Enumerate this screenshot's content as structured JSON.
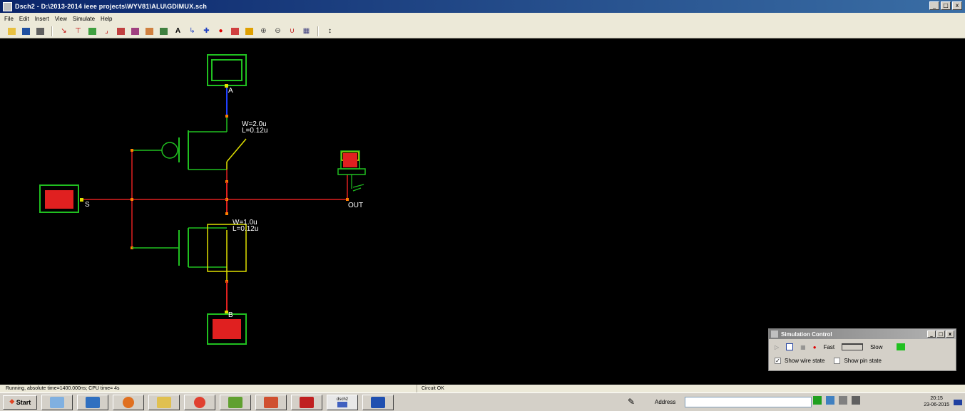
{
  "window": {
    "title": "Dsch2 - D:\\2013-2014 ieee projects\\WYV81\\ALU\\GDIMUX.sch",
    "controls": [
      "_",
      "□",
      "x"
    ]
  },
  "menu": [
    "File",
    "Edit",
    "Insert",
    "View",
    "Simulate",
    "Help"
  ],
  "toolbar": {
    "icons": [
      "open-icon",
      "save-icon",
      "print-icon",
      "arrow-icon",
      "nmos-icon",
      "pmos-icon",
      "wire-icon",
      "component-icon",
      "symbol-icon",
      "grid-icon",
      "bus-icon",
      "text-icon",
      "connect-icon",
      "line-icon",
      "run-icon",
      "timing-icon",
      "chart-icon",
      "zoom-in-icon",
      "zoom-out-icon",
      "extract-icon",
      "layout-icon",
      "move-icon"
    ]
  },
  "schematic": {
    "labels": {
      "A": "A",
      "B": "B",
      "S": "S",
      "OUT": "OUT",
      "pmos_w": "W=2.0u",
      "pmos_l": "L=0.12u",
      "nmos_w": "W=1.0u",
      "nmos_l": "L=0.12u"
    },
    "colors": {
      "active_wire": "#e02020",
      "inactive_wire": "#20c020",
      "blue_wire": "#2040ff",
      "device": "#e0e000",
      "node": "#ff8000"
    }
  },
  "status": {
    "left": "Running, absolute time=1400.000ns; CPU time= 4s",
    "right": "Circuit OK"
  },
  "sim_control": {
    "title": "Simulation Control",
    "fast_label": "Fast",
    "slow_label": "Slow",
    "show_wire_state": "Show wire state",
    "show_pin_state": "Show pin state",
    "show_wire_checked": true,
    "show_pin_checked": false
  },
  "taskbar": {
    "start": "Start",
    "tasks": [
      "explorer",
      "outlook",
      "firefox",
      "folder",
      "chrome",
      "media",
      "powerpoint",
      "acrobat",
      "dsch2",
      "word"
    ],
    "dsch2_label": "dsch2",
    "address_label": "Address",
    "address_value": "",
    "time": "20:15",
    "date": "23-06-2015"
  }
}
